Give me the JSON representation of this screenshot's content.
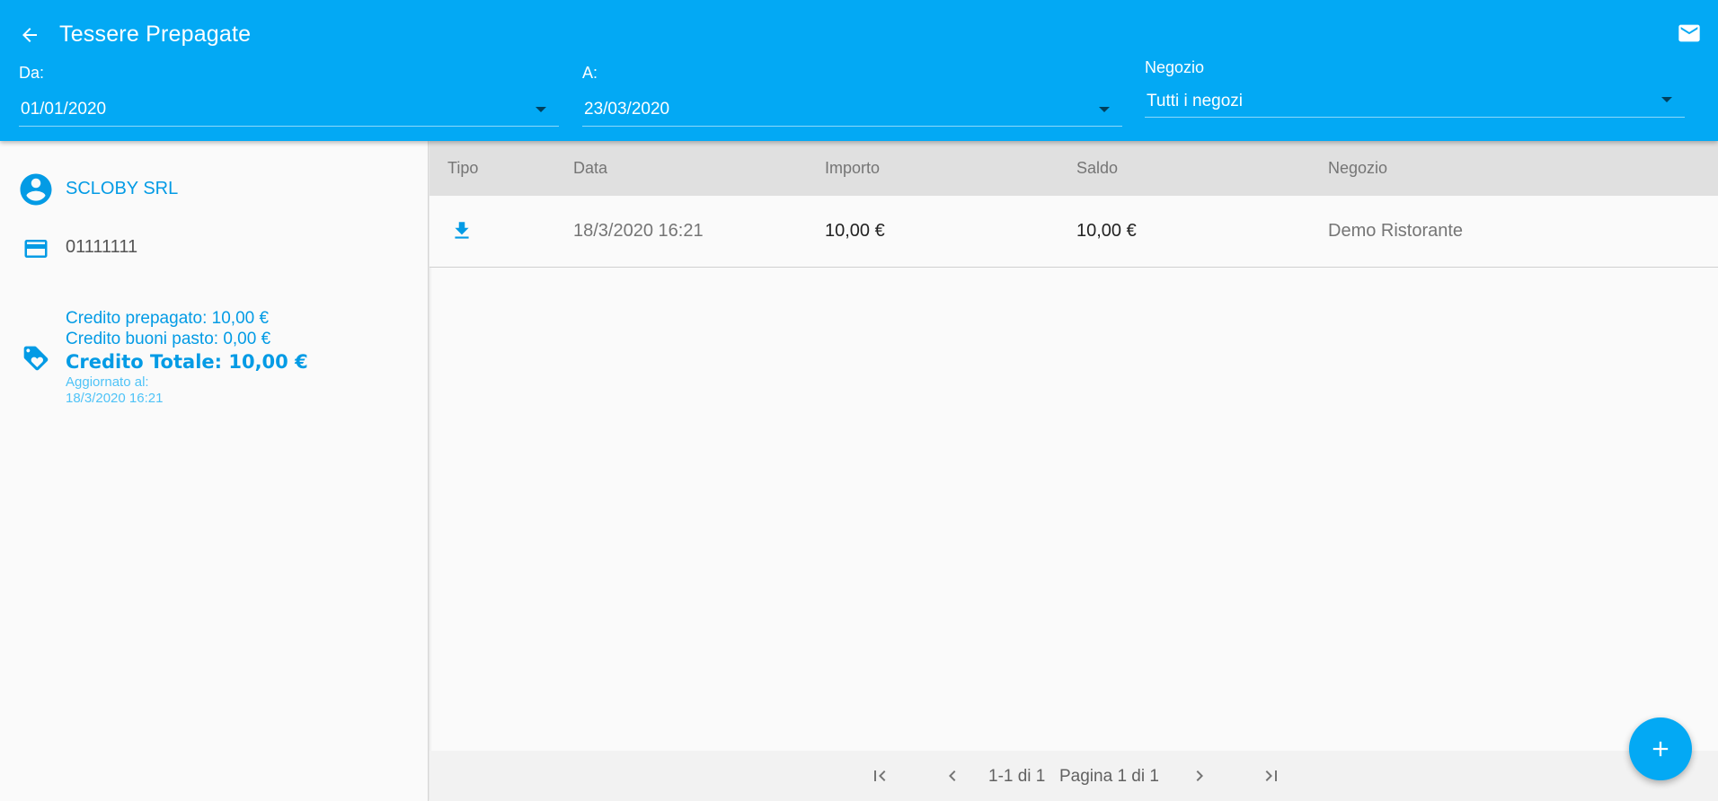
{
  "header": {
    "title": "Tessere Prepagate",
    "back_icon": "arrow-left-icon",
    "mail_icon": "mail-icon",
    "filters": {
      "from": {
        "label": "Da:",
        "value": "01/01/2020"
      },
      "to": {
        "label": "A:",
        "value": "23/03/2020"
      },
      "shop": {
        "label": "Negozio",
        "value": "Tutti i negozi"
      }
    }
  },
  "sidebar": {
    "customer_name": "SCLOBY SRL",
    "card_number": "01111111",
    "credit": {
      "prepaid": "Credito prepagato: 10,00 €",
      "meal_vouchers": "Credito buoni pasto: 0,00 €",
      "total": "Credito Totale: 10,00 €",
      "updated_label": "Aggiornato al:",
      "updated_value": "18/3/2020 16:21"
    }
  },
  "table": {
    "columns": [
      "Tipo",
      "Data",
      "Importo",
      "Saldo",
      "Negozio"
    ],
    "rows": [
      {
        "type_icon": "download-icon",
        "date": "18/3/2020 16:21",
        "amount": "10,00 €",
        "balance": "10,00 €",
        "shop": "Demo Ristorante"
      }
    ]
  },
  "pagination": {
    "range": "1-1 di 1",
    "page": "Pagina 1 di 1"
  },
  "colors": {
    "primary": "#03a9f4",
    "accent_text": "#039be5"
  }
}
